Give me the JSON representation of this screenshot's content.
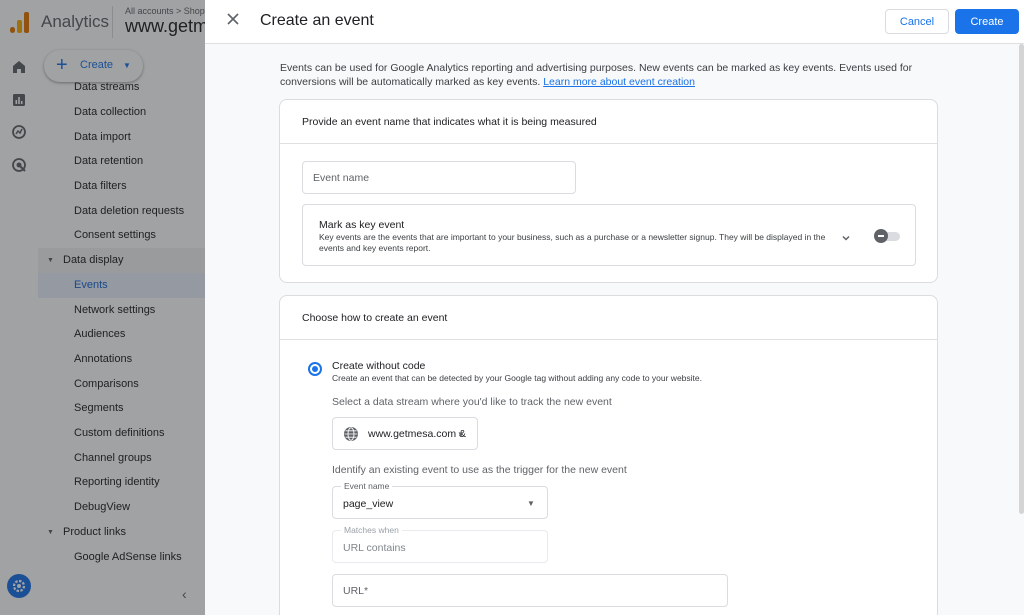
{
  "app": {
    "name": "Analytics",
    "account_crumb": "All accounts > Shopify",
    "property_name": "www.getmesa"
  },
  "leftnav": {
    "create_label": "Create",
    "items": [
      {
        "label": "Data streams"
      },
      {
        "label": "Data collection"
      },
      {
        "label": "Data import"
      },
      {
        "label": "Data retention"
      },
      {
        "label": "Data filters"
      },
      {
        "label": "Data deletion requests"
      },
      {
        "label": "Consent settings"
      },
      {
        "label": "Data display"
      },
      {
        "label": "Events"
      },
      {
        "label": "Network settings"
      },
      {
        "label": "Audiences"
      },
      {
        "label": "Annotations"
      },
      {
        "label": "Comparisons"
      },
      {
        "label": "Segments"
      },
      {
        "label": "Custom definitions"
      },
      {
        "label": "Channel groups"
      },
      {
        "label": "Reporting identity"
      },
      {
        "label": "DebugView"
      },
      {
        "label": "Product links"
      },
      {
        "label": "Google AdSense links"
      }
    ]
  },
  "panel": {
    "title": "Create an event",
    "cancel_label": "Cancel",
    "create_label": "Create",
    "intro_text": "Events can be used for Google Analytics reporting and advertising purposes. New events can be marked as key events. Events used for conversions will be automatically marked as key events.",
    "intro_link": "Learn more about event creation",
    "name_card": {
      "heading": "Provide an event name that indicates what it is being measured",
      "event_name_placeholder": "Event name",
      "key_event_title": "Mark as key event",
      "key_event_desc": "Key events are the events that are important to your business, such as a purchase or a newsletter signup. They will be displayed in the events and key events report."
    },
    "method_card": {
      "heading": "Choose how to create an event",
      "option_title": "Create without code",
      "option_desc": "Create an event that can be detected by your Google tag without adding any code to your website.",
      "stream_prompt": "Select a data stream where you'd like to track the new event",
      "stream_value": "www.getmesa.com &",
      "trigger_prompt": "Identify an existing event to use as the trigger for the new event",
      "event_name_legend": "Event name",
      "event_name_value": "page_view",
      "matches_legend": "Matches when",
      "matches_value": "URL contains",
      "url_placeholder": "URL*"
    }
  },
  "colors": {
    "accent": "#1a73e8",
    "overlay": "#202124",
    "active_nav_bg": "#e8f0fe"
  },
  "icons": [
    "close-icon",
    "chevron-down-icon",
    "globe-icon",
    "home-icon",
    "reports-icon",
    "explore-icon",
    "advertising-icon",
    "settings-icon",
    "chevron-left-icon"
  ]
}
